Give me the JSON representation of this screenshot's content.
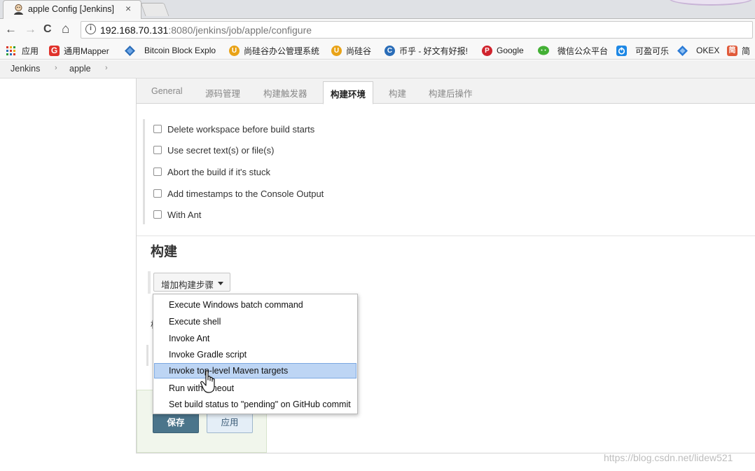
{
  "browser": {
    "tab_title": "apple Config [Jenkins]",
    "tab_close": "×",
    "url_host": "192.168.70.131",
    "url_rest": ":8080/jenkins/job/apple/configure",
    "info_glyph": "i",
    "nav": {
      "back": "←",
      "forward": "→",
      "reload": "C",
      "home": "⌂"
    }
  },
  "bookmarks": [
    {
      "label": "应用",
      "icon": "apps-grid-icon",
      "color": "#d33b2c"
    },
    {
      "label": "通用Mapper",
      "icon": "G",
      "color": "#e0322b"
    },
    {
      "label": "Bitcoin Block Explo",
      "icon": "diamond-icon",
      "color": "#2a6db8"
    },
    {
      "label": "尚硅谷办公管理系统",
      "icon": "U",
      "color": "#e9a317"
    },
    {
      "label": "尚硅谷",
      "icon": "U",
      "color": "#e9a317"
    },
    {
      "label": "币乎 - 好文有好报!",
      "icon": "C",
      "color": "#2a6db8"
    },
    {
      "label": "Google",
      "icon": "P",
      "color": "#d0232d"
    },
    {
      "label": "微信公众平台",
      "icon": "chat-icon",
      "color": "#43b035"
    },
    {
      "label": "可盈可乐",
      "icon": "power-icon",
      "color": "#1e88e5"
    },
    {
      "label": "OKEX",
      "icon": "diamond-icon",
      "color": "#2b7bd6"
    },
    {
      "label": "简",
      "icon": "简",
      "color": "#e05a3a"
    }
  ],
  "breadcrumb": {
    "items": [
      "Jenkins",
      "apple"
    ],
    "separator": "›"
  },
  "config_tabs": [
    {
      "label": "General",
      "active": false
    },
    {
      "label": "源码管理",
      "active": false
    },
    {
      "label": "构建触发器",
      "active": false
    },
    {
      "label": "构建环境",
      "active": true
    },
    {
      "label": "构建",
      "active": false
    },
    {
      "label": "构建后操作",
      "active": false
    }
  ],
  "build_env_options": [
    "Delete workspace before build starts",
    "Use secret text(s) or file(s)",
    "Abort the build if it's stuck",
    "Add timestamps to the Console Output",
    "With Ant"
  ],
  "build_section": {
    "title": "构建",
    "add_step_label": "增加构建步骤"
  },
  "post_build_label": "构",
  "dropdown": {
    "items": [
      "Execute Windows batch command",
      "Execute shell",
      "Invoke Ant",
      "Invoke Gradle script",
      "Invoke top-level Maven targets",
      "Run with timeout",
      "Set build status to \"pending\" on GitHub commit"
    ],
    "highlighted": "Invoke top-level Maven targets"
  },
  "actions": {
    "save": "保存",
    "apply": "应用"
  },
  "watermark": "https://blog.csdn.net/lidew521",
  "colors": {
    "save_bg": "#4b758b",
    "apply_bg": "#e4eef7",
    "menu_highlight": "#bdd5f4"
  }
}
